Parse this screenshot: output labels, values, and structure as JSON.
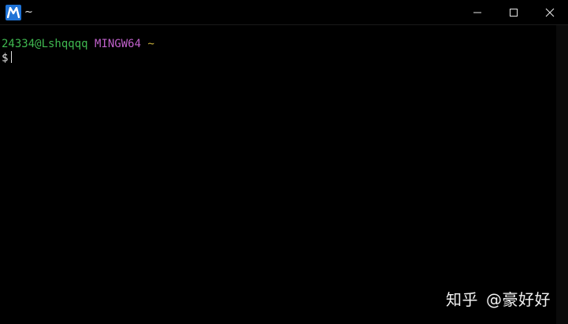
{
  "window": {
    "title": "~",
    "icon": "mintty-m-icon",
    "controls": {
      "minimize": "minimize-icon",
      "maximize": "maximize-icon",
      "close": "close-icon"
    }
  },
  "terminal": {
    "prompt": {
      "user_host": "24334@Lshqqqq",
      "system": "MINGW64",
      "cwd": "~",
      "symbol": "$"
    }
  },
  "watermark": {
    "site": "知乎",
    "author": "@豪好好"
  },
  "colors": {
    "background": "#000000",
    "user_host": "#3fb950",
    "system": "#c061cb",
    "cwd": "#c9b13a",
    "text": "#e0e0e0",
    "icon_bg": "#1f73d6"
  }
}
